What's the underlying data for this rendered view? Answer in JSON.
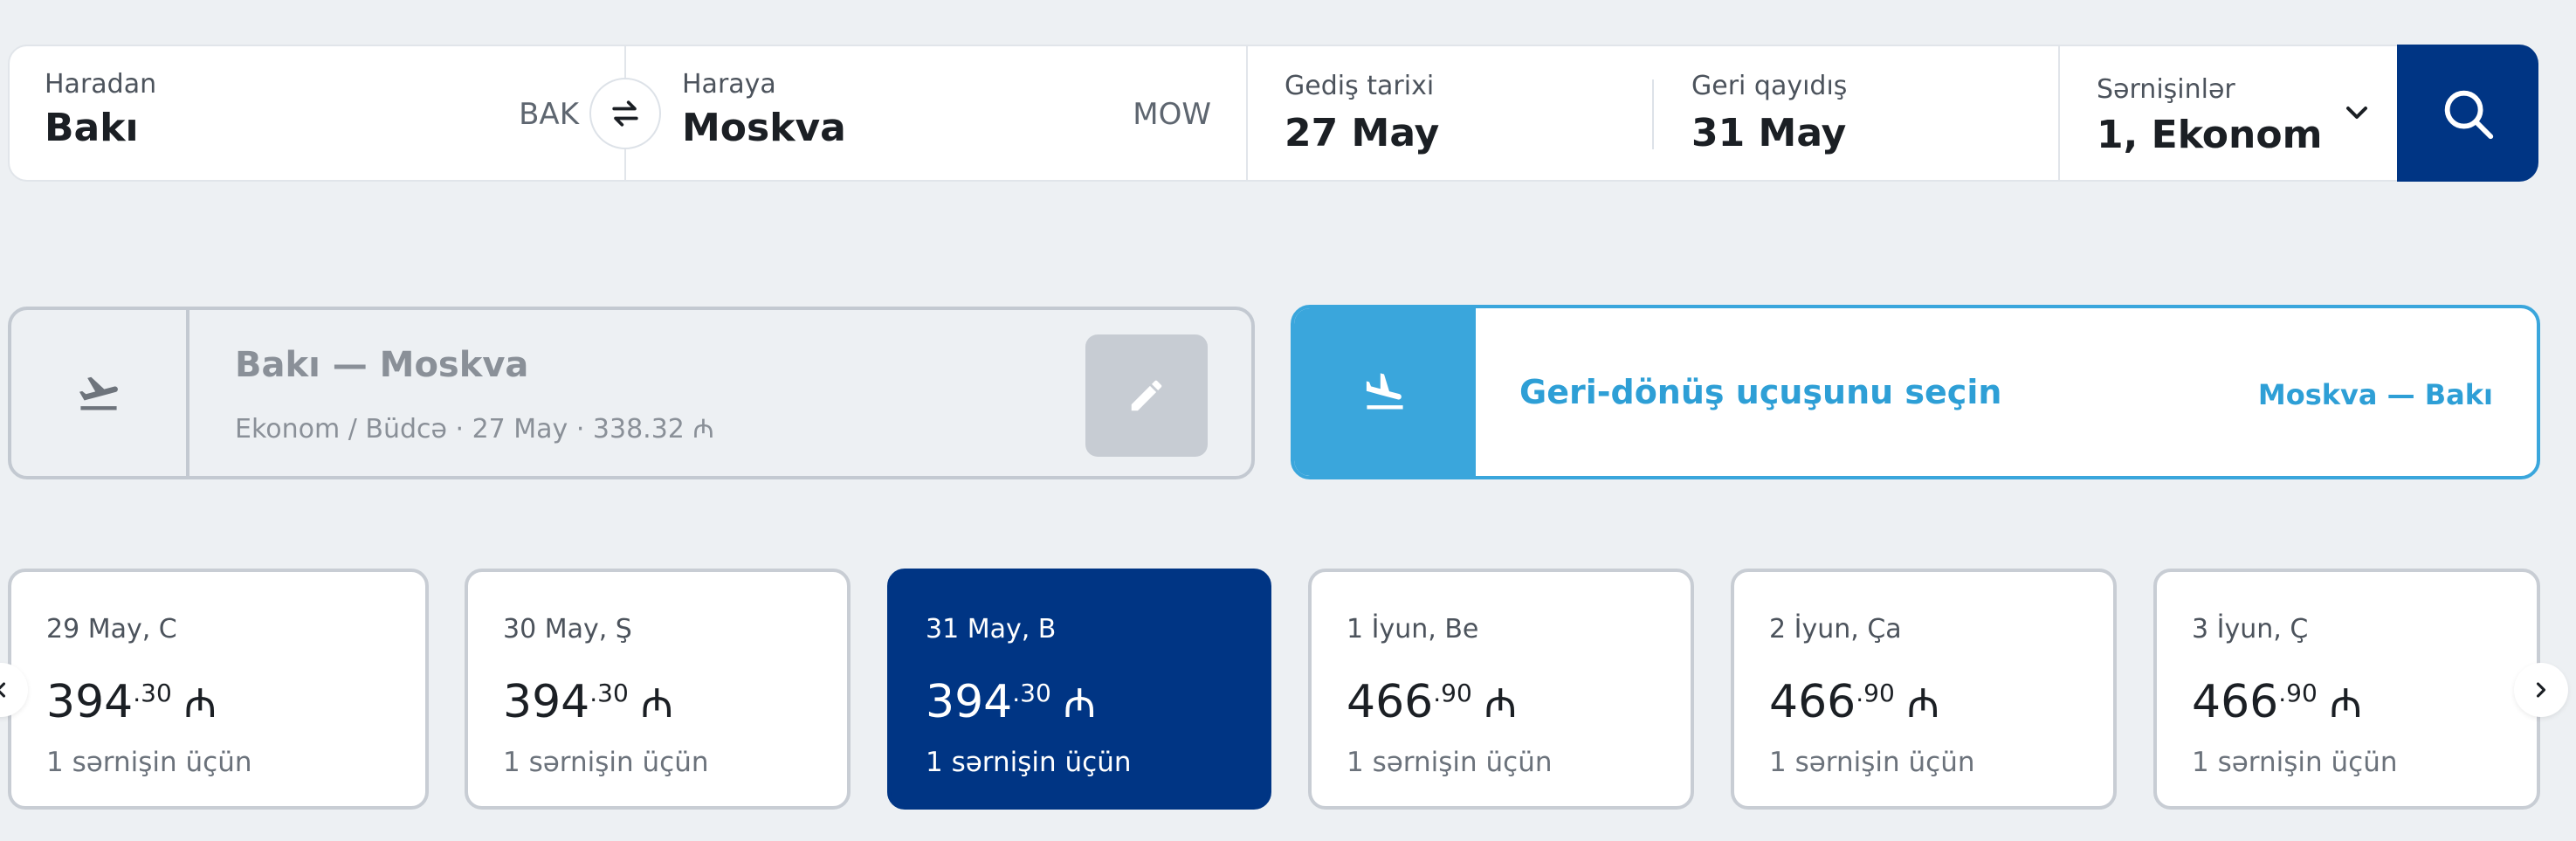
{
  "search": {
    "from": {
      "label": "Haradan",
      "city": "Bakı",
      "code": "BAK"
    },
    "to": {
      "label": "Haraya",
      "city": "Moskva",
      "code": "MOW"
    },
    "departure": {
      "label": "Gediş tarixi",
      "date": "27 May"
    },
    "return": {
      "label": "Geri qayıdış",
      "date": "31 May"
    },
    "passengers": {
      "label": "Sərnişinlər",
      "value": "1, Ekonom"
    },
    "icons": {
      "swap": "swap-arrows-icon",
      "dropdown": "chevron-down-icon",
      "search": "search-icon"
    }
  },
  "outbound": {
    "route": "Bakı — Moskva",
    "details": "Ekonom / Büdcə · 27 May · 338.32 ₼",
    "icon": "plane-takeoff-icon",
    "edit_icon": "pencil-icon"
  },
  "return_select": {
    "title": "Geri-dönüş uçuşunu seçin",
    "route": "Moskva — Bakı",
    "icon": "plane-landing-icon"
  },
  "date_options": [
    {
      "date": "29 May, C",
      "price_int": "394",
      "price_dec": ".30",
      "currency": "₼",
      "per": "1 sərnişin üçün",
      "selected": false
    },
    {
      "date": "30 May, Ş",
      "price_int": "394",
      "price_dec": ".30",
      "currency": "₼",
      "per": "1 sərnişin üçün",
      "selected": false
    },
    {
      "date": "31 May, B",
      "price_int": "394",
      "price_dec": ".30",
      "currency": "₼",
      "per": "1 sərnişin üçün",
      "selected": true
    },
    {
      "date": "1 İyun, Be",
      "price_int": "466",
      "price_dec": ".90",
      "currency": "₼",
      "per": "1 sərnişin üçün",
      "selected": false
    },
    {
      "date": "2 İyun, Ça",
      "price_int": "466",
      "price_dec": ".90",
      "currency": "₼",
      "per": "1 sərnişin üçün",
      "selected": false
    },
    {
      "date": "3 İyun, Ç",
      "price_int": "466",
      "price_dec": ".90",
      "currency": "₼",
      "per": "1 sərnişin üçün",
      "selected": false
    }
  ],
  "colors": {
    "primary": "#003584",
    "accent": "#3aa6dc",
    "background": "#edf0f3"
  }
}
